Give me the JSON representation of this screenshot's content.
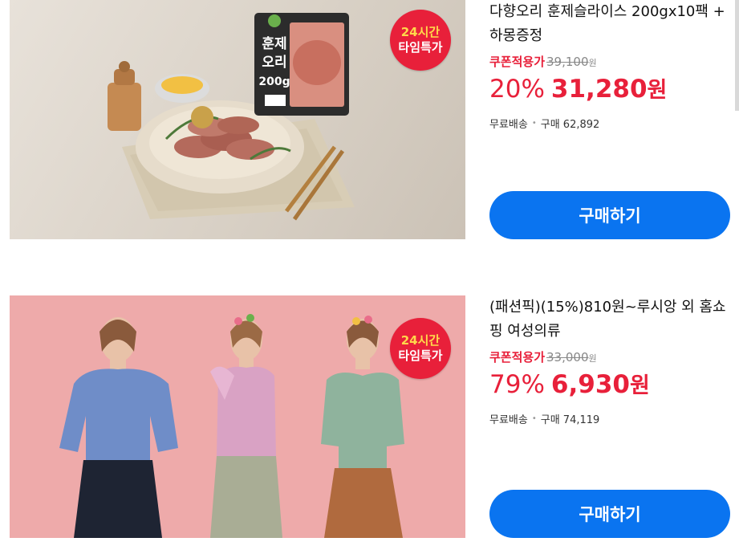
{
  "products": [
    {
      "title": "다향오리 훈제슬라이스 200gx10팩 + 하몽증정",
      "badge_line1": "24시간",
      "badge_line2": "타임특가",
      "package_text": [
        "훈제",
        "오리",
        "200g"
      ],
      "coupon_label": "쿠폰적용가",
      "original_price": "39,100",
      "original_unit": "원",
      "discount": "20%",
      "sale_price": "31,280",
      "sale_unit": "원",
      "shipping": "무료배송",
      "purchases": "구매 62,892",
      "buy_label": "구매하기"
    },
    {
      "title": "(패션픽)(15%)810원~루시앙 외 홈쇼핑 여성의류",
      "badge_line1": "24시간",
      "badge_line2": "타임특가",
      "coupon_label": "쿠폰적용가",
      "original_price": "33,000",
      "original_unit": "원",
      "discount": "79%",
      "sale_price": "6,930",
      "sale_unit": "원",
      "shipping": "무료배송",
      "purchases": "구매 74,119",
      "buy_label": "구매하기"
    }
  ],
  "colors": {
    "accent_red": "#e8203a",
    "button_blue": "#0a74f0",
    "fashion_bg": "#eeaaaa"
  }
}
